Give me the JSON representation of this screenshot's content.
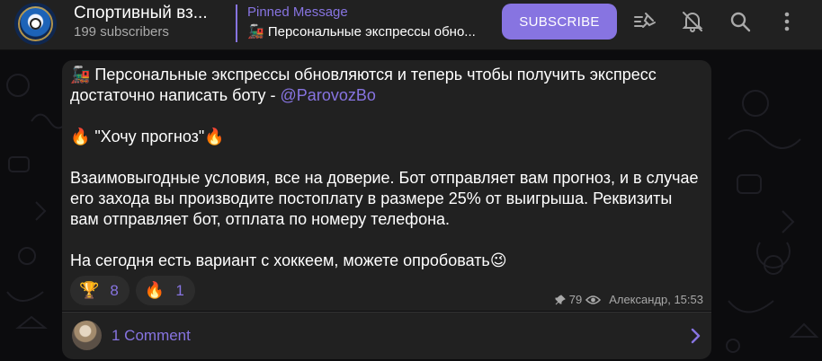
{
  "header": {
    "title": "Спортивный вз...",
    "subscribers": "199 subscribers",
    "pinned_title": "Pinned Message",
    "pinned_text": "🚂 Персональные экспрессы обно...",
    "subscribe_label": "SUBSCRIBE",
    "icons": [
      "unpin-icon",
      "muted-bell-icon",
      "search-icon",
      "more-icon"
    ]
  },
  "message": {
    "paragraphs": [
      {
        "text": "🚂 Персональные экспрессы обновляются и теперь чтобы получить экспресс достаточно написать боту - ",
        "mention": "@ParovozBo"
      },
      {
        "text": "🔥 \"Хочу прогноз\"🔥"
      },
      {
        "text": "Взаимовыгодные условия, все на доверие. Бот отправляет вам прогноз, и в случае его захода вы производите постоплату в размере 25% от выигрыша. Реквизиты вам отправляет бот, отплата по номеру телефона."
      },
      {
        "text": "На сегодня есть вариант с хоккеем, можете опробовать😉"
      }
    ],
    "reactions": [
      {
        "emoji": "🏆",
        "count": "8"
      },
      {
        "emoji": "🔥",
        "count": "1"
      }
    ],
    "views": "79",
    "author_time": "Александр, 15:53"
  },
  "comments": {
    "label": "1 Comment"
  },
  "colors": {
    "accent": "#8774e1",
    "bubble": "#212121",
    "header": "#212121"
  }
}
